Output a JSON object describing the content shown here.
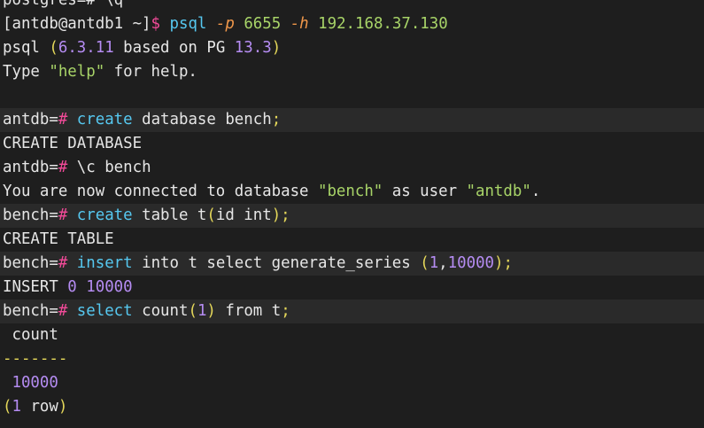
{
  "colors": {
    "background": "#1e1e1e",
    "highlight_row": "#2a2a2a",
    "text": "#e6e6e6",
    "prompt_hash": "#f44b9a",
    "keyword": "#56c8f0",
    "string": "#a8d468",
    "number": "#b58cf2",
    "punctuation": "#e4d75a",
    "flag": "#f0974a"
  },
  "lines": [
    {
      "highlight": false,
      "segments": [
        {
          "text": "postgres=# \\q",
          "c": "white"
        }
      ]
    },
    {
      "highlight": false,
      "segments": [
        {
          "text": "[antdb@antdb1 ~]",
          "c": "white"
        },
        {
          "text": "$",
          "c": "pink"
        },
        {
          "text": " ",
          "c": "white"
        },
        {
          "text": "psql",
          "c": "cyan"
        },
        {
          "text": " ",
          "c": "white"
        },
        {
          "text": "-p",
          "c": "orange"
        },
        {
          "text": " ",
          "c": "white"
        },
        {
          "text": "6655",
          "c": "green"
        },
        {
          "text": " ",
          "c": "white"
        },
        {
          "text": "-h",
          "c": "orange"
        },
        {
          "text": " ",
          "c": "white"
        },
        {
          "text": "192.168.37.130",
          "c": "green"
        }
      ]
    },
    {
      "highlight": false,
      "segments": [
        {
          "text": "psql ",
          "c": "white"
        },
        {
          "text": "(",
          "c": "yellow"
        },
        {
          "text": "6.3.11",
          "c": "purple"
        },
        {
          "text": " based on PG ",
          "c": "white"
        },
        {
          "text": "13.3",
          "c": "purple"
        },
        {
          "text": ")",
          "c": "yellow"
        }
      ]
    },
    {
      "highlight": false,
      "segments": [
        {
          "text": "Type ",
          "c": "white"
        },
        {
          "text": "\"help\"",
          "c": "green"
        },
        {
          "text": " for help.",
          "c": "white"
        }
      ]
    },
    {
      "highlight": false,
      "segments": [
        {
          "text": "",
          "c": "white"
        }
      ]
    },
    {
      "highlight": true,
      "segments": [
        {
          "text": "antdb=",
          "c": "white"
        },
        {
          "text": "#",
          "c": "pink"
        },
        {
          "text": " ",
          "c": "white"
        },
        {
          "text": "create",
          "c": "cyan"
        },
        {
          "text": " database bench",
          "c": "white"
        },
        {
          "text": ";",
          "c": "yellow"
        }
      ]
    },
    {
      "highlight": false,
      "segments": [
        {
          "text": "CREATE DATABASE",
          "c": "white"
        }
      ]
    },
    {
      "highlight": false,
      "segments": [
        {
          "text": "antdb=",
          "c": "white"
        },
        {
          "text": "#",
          "c": "pink"
        },
        {
          "text": " \\c bench",
          "c": "white"
        }
      ]
    },
    {
      "highlight": false,
      "segments": [
        {
          "text": "You are now connected to database ",
          "c": "white"
        },
        {
          "text": "\"bench\"",
          "c": "green"
        },
        {
          "text": " as user ",
          "c": "white"
        },
        {
          "text": "\"antdb\"",
          "c": "green"
        },
        {
          "text": ".",
          "c": "white"
        }
      ]
    },
    {
      "highlight": true,
      "segments": [
        {
          "text": "bench=",
          "c": "white"
        },
        {
          "text": "#",
          "c": "pink"
        },
        {
          "text": " ",
          "c": "white"
        },
        {
          "text": "create",
          "c": "cyan"
        },
        {
          "text": " table t",
          "c": "white"
        },
        {
          "text": "(",
          "c": "yellow"
        },
        {
          "text": "id int",
          "c": "white"
        },
        {
          "text": ");",
          "c": "yellow"
        }
      ]
    },
    {
      "highlight": false,
      "segments": [
        {
          "text": "CREATE TABLE",
          "c": "white"
        }
      ]
    },
    {
      "highlight": true,
      "segments": [
        {
          "text": "bench=",
          "c": "white"
        },
        {
          "text": "#",
          "c": "pink"
        },
        {
          "text": " ",
          "c": "white"
        },
        {
          "text": "insert",
          "c": "cyan"
        },
        {
          "text": " into t select generate_series ",
          "c": "white"
        },
        {
          "text": "(",
          "c": "yellow"
        },
        {
          "text": "1",
          "c": "purple"
        },
        {
          "text": ",",
          "c": "white"
        },
        {
          "text": "10000",
          "c": "purple"
        },
        {
          "text": ");",
          "c": "yellow"
        }
      ]
    },
    {
      "highlight": false,
      "segments": [
        {
          "text": "INSERT ",
          "c": "white"
        },
        {
          "text": "0",
          "c": "purple"
        },
        {
          "text": " ",
          "c": "white"
        },
        {
          "text": "10000",
          "c": "purple"
        }
      ]
    },
    {
      "highlight": true,
      "segments": [
        {
          "text": "bench=",
          "c": "white"
        },
        {
          "text": "#",
          "c": "pink"
        },
        {
          "text": " ",
          "c": "white"
        },
        {
          "text": "select",
          "c": "cyan"
        },
        {
          "text": " count",
          "c": "white"
        },
        {
          "text": "(",
          "c": "yellow"
        },
        {
          "text": "1",
          "c": "purple"
        },
        {
          "text": ")",
          "c": "yellow"
        },
        {
          "text": " from t",
          "c": "white"
        },
        {
          "text": ";",
          "c": "yellow"
        }
      ]
    },
    {
      "highlight": false,
      "segments": [
        {
          "text": " count",
          "c": "white"
        }
      ]
    },
    {
      "highlight": false,
      "segments": [
        {
          "text": "-------",
          "c": "yellow"
        }
      ]
    },
    {
      "highlight": false,
      "segments": [
        {
          "text": " ",
          "c": "white"
        },
        {
          "text": "10000",
          "c": "purple"
        }
      ]
    },
    {
      "highlight": false,
      "segments": [
        {
          "text": "(",
          "c": "yellow"
        },
        {
          "text": "1",
          "c": "purple"
        },
        {
          "text": " row",
          "c": "white"
        },
        {
          "text": ")",
          "c": "yellow"
        }
      ]
    }
  ]
}
